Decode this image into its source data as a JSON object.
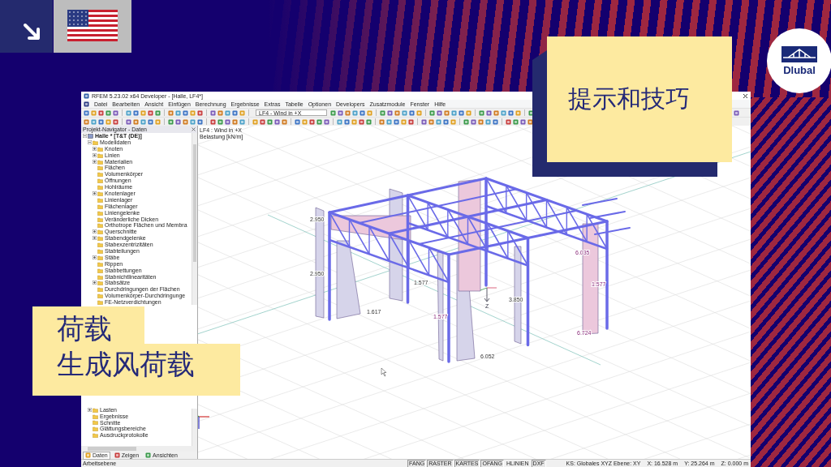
{
  "logo": {
    "text": "Dlubal"
  },
  "tip_note": {
    "text": "提示和技巧"
  },
  "topic_note": {
    "lines": [
      "荷载",
      "生成风荷载"
    ]
  },
  "window": {
    "title": "RFEM 5.23.02 x64 Developer - [Halle, LF4*]",
    "menu": [
      "Datei",
      "Bearbeiten",
      "Ansicht",
      "Einfügen",
      "Berechnung",
      "Ergebnisse",
      "Extras",
      "Tabelle",
      "Optionen",
      "Developers",
      "Zusatzmodule",
      "Fenster",
      "Hilfe"
    ],
    "load_case": "LF4 - Wind in +X"
  },
  "navigator": {
    "title": "Projekt-Navigator - Daten",
    "tree": [
      {
        "label": "Halle * [T&T (DE)]",
        "expanded": true,
        "children": [
          {
            "label": "Modelldaten",
            "expanded": true,
            "children": [
              {
                "label": "Knoten",
                "expanded": false
              },
              {
                "label": "Linien",
                "expanded": false
              },
              {
                "label": "Materialien",
                "expanded": false
              },
              {
                "label": "Flächen"
              },
              {
                "label": "Volumenkörper"
              },
              {
                "label": "Öffnungen"
              },
              {
                "label": "Hohlräume"
              },
              {
                "label": "Knotenlager",
                "expanded": false
              },
              {
                "label": "Linienlager"
              },
              {
                "label": "Flächenlager"
              },
              {
                "label": "Liniengelenke"
              },
              {
                "label": "Veränderliche Dicken"
              },
              {
                "label": "Orthotrope Flächen und Membra"
              },
              {
                "label": "Querschnitte",
                "expanded": false
              },
              {
                "label": "Stabendgelenke",
                "expanded": false
              },
              {
                "label": "Stabexzentrizitäten"
              },
              {
                "label": "Stabteilungen"
              },
              {
                "label": "Stäbe",
                "expanded": false
              },
              {
                "label": "Rippen"
              },
              {
                "label": "Stabbettungen"
              },
              {
                "label": "Stabnichtlinearitäten"
              },
              {
                "label": "Stabsätze",
                "expanded": false
              },
              {
                "label": "Durchdringungen der Flächen"
              },
              {
                "label": "Volumenkörper-Durchdringunge"
              },
              {
                "label": "FE-Netzverdichtungen"
              }
            ]
          },
          {
            "label": "Lasten",
            "expanded": false
          },
          {
            "label": "Ergebnisse"
          },
          {
            "label": "Schnitte"
          },
          {
            "label": "Glättungsbereiche"
          },
          {
            "label": "Ausdruckprotokolle"
          }
        ]
      }
    ],
    "tabs": [
      {
        "label": "Daten",
        "selected": true
      },
      {
        "label": "Zeigen",
        "selected": false
      },
      {
        "label": "Ansichten",
        "selected": false
      }
    ]
  },
  "view": {
    "header": [
      "LF4 : Wind in +X",
      "Belastung [kN/m]"
    ],
    "load_values": [
      "2.950",
      "2.950",
      "1.617",
      "1.577",
      "1.577",
      "3.850",
      "6.052",
      "6.035",
      "1.577",
      "6.724"
    ],
    "axis_label": "Z"
  },
  "status_bar": {
    "text": "Arbeitsebene",
    "toggles": [
      {
        "label": "FANG",
        "on": false
      },
      {
        "label": "RASTER",
        "on": false
      },
      {
        "label": "KARTES",
        "on": false
      },
      {
        "label": "OFANG",
        "on": false
      },
      {
        "label": "HLINIEN",
        "on": true
      },
      {
        "label": "DXF",
        "on": false
      }
    ],
    "coordinate_system": "KS: Globales XYZ Ebene: XY",
    "coordinates": [
      "X: 16.528 m",
      "Y: 25.264 m",
      "Z: 0.000 m"
    ]
  }
}
